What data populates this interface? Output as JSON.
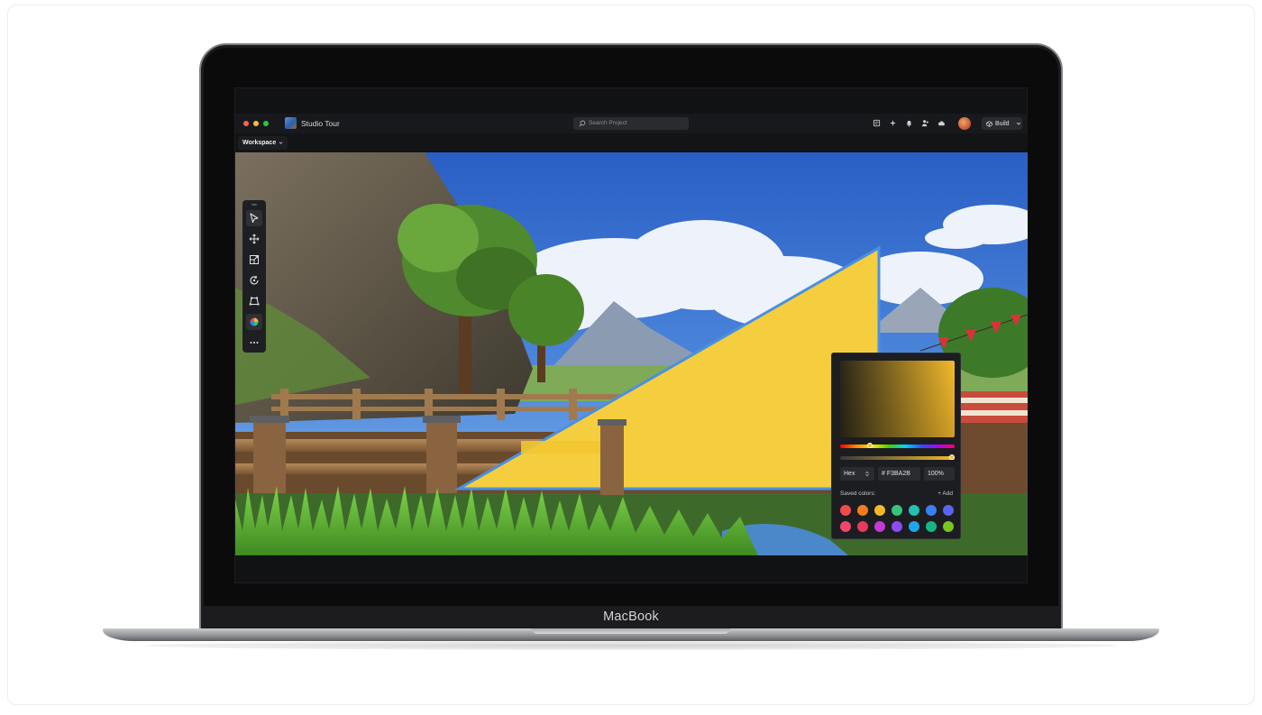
{
  "laptop": {
    "brand": "MacBook"
  },
  "window": {
    "title": "Studio Tour",
    "controls": [
      "close",
      "minimize",
      "zoom"
    ]
  },
  "search": {
    "placeholder": "Search Project"
  },
  "toolbar_right": {
    "icons": [
      "notes-icon",
      "sparkle-icon",
      "bell-icon",
      "people-icon",
      "cloud-icon"
    ],
    "build_label": "Build"
  },
  "menubar": {
    "workspace_label": "Workspace"
  },
  "tools": [
    "select-tool-icon",
    "move-tool-icon",
    "scale-tool-icon",
    "rotate-tool-icon",
    "transform-tool-icon",
    "color-tool-icon",
    "more-icon"
  ],
  "color_picker": {
    "selected_color": "#F3BA2B",
    "hue_position": 0.26,
    "alpha_position": 1.0,
    "format": "Hex",
    "hex_value": "# F3BA2B",
    "opacity": "100%",
    "saved_label": "Saved colors:",
    "add_label": "+ Add",
    "saved_colors": [
      "#f04b4b",
      "#f57b20",
      "#f5b82a",
      "#36c47a",
      "#22c2b0",
      "#3b7ff0",
      "#5b63f0",
      "#f0466e",
      "#e83a5e",
      "#c23bd4",
      "#8b4cf0",
      "#1ea6ea",
      "#17b586",
      "#7ac620"
    ]
  },
  "colors": {
    "accent": "#F3BA2B",
    "panel": "#1C1D20",
    "selection": "#4a90e2"
  }
}
